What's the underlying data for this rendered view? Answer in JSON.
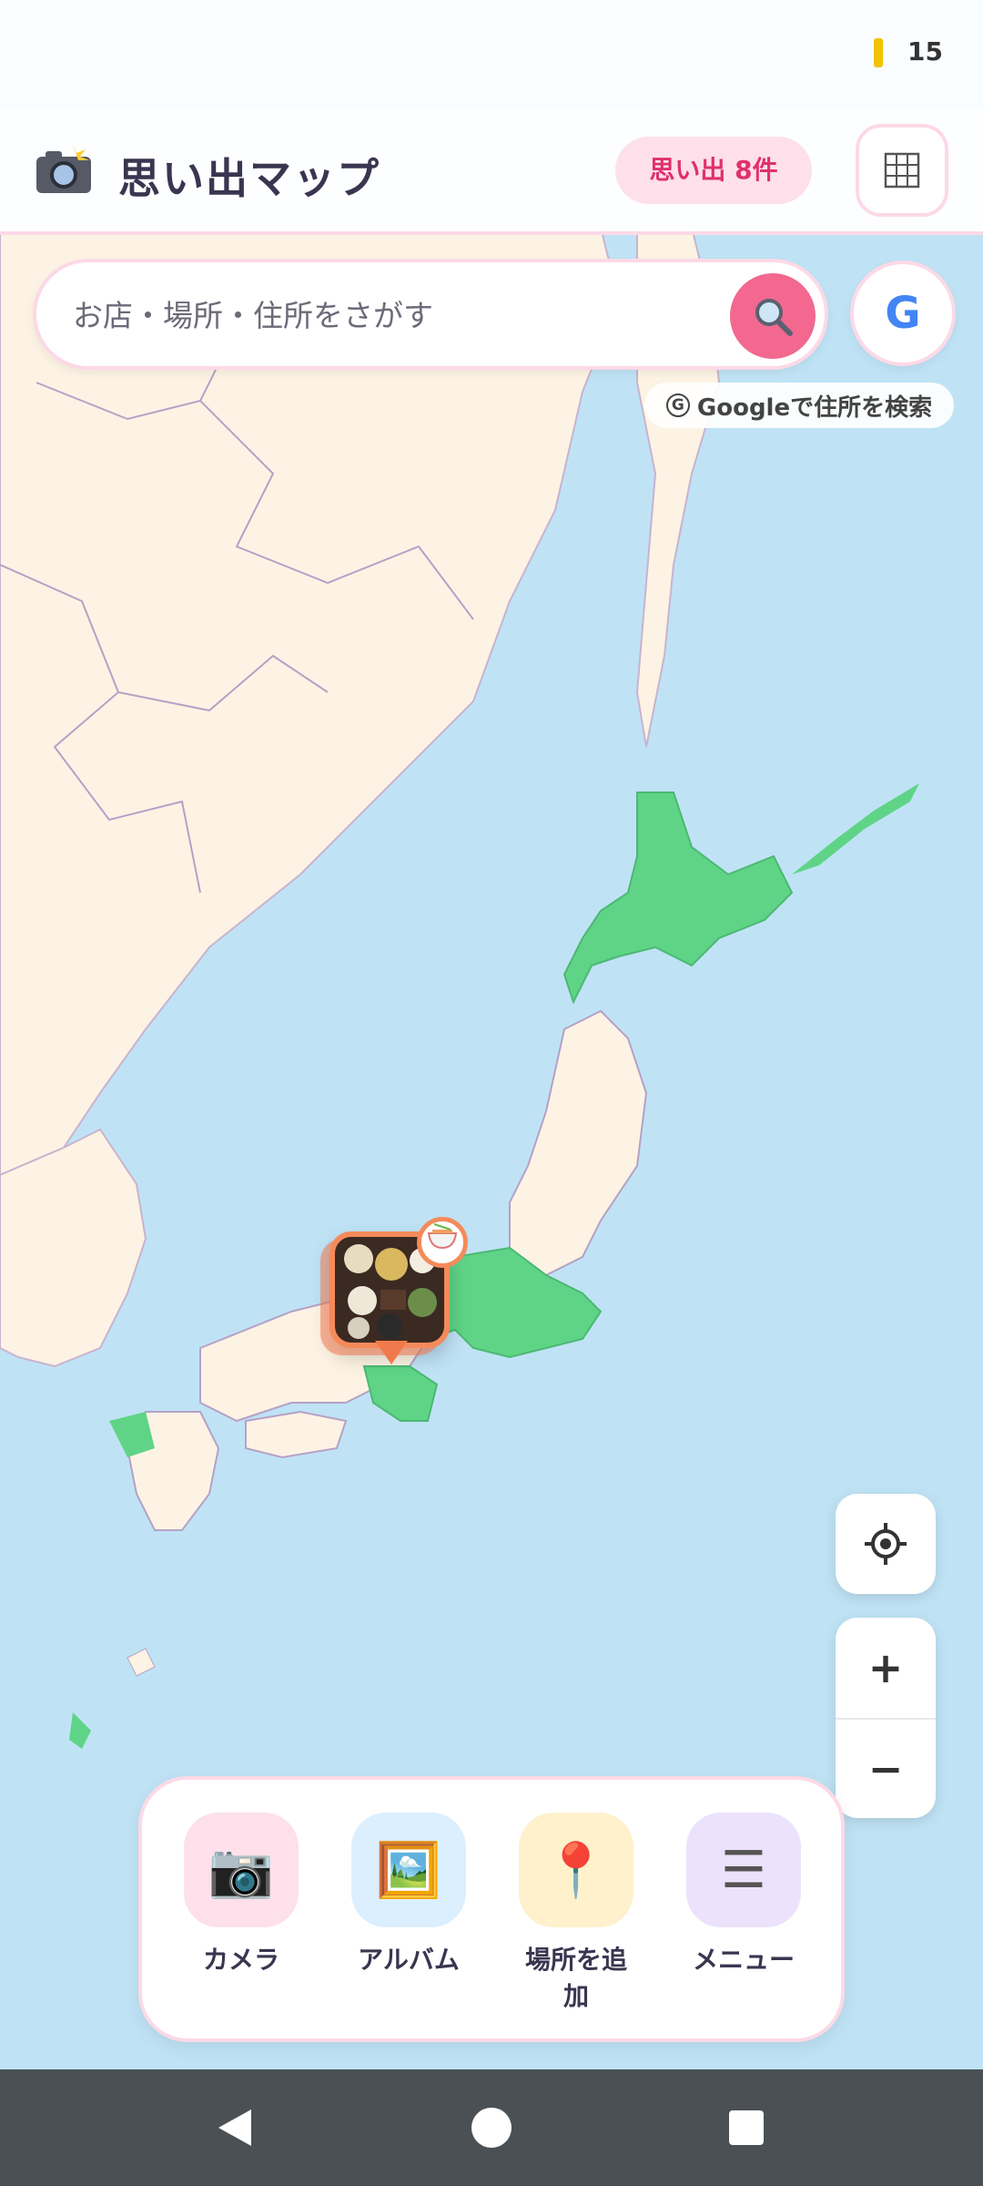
{
  "status_bar": {
    "battery_level": "15",
    "battery_color": "#f2c300"
  },
  "header": {
    "app_icon": "camera-flash-icon",
    "title": "思い出マップ",
    "memory_count_badge": "思い出 8件",
    "grid_button_icon": "grid-icon"
  },
  "search": {
    "placeholder": "お店・場所・住所をさがす",
    "value": "",
    "search_button_icon": "magnifier-icon",
    "google_button_label": "G",
    "google_hint_icon": "G",
    "google_hint": "Googleで住所を検索"
  },
  "map": {
    "memory_pin": {
      "photo": "japanese-set-meal-photo",
      "category_icon": "ramen-bowl-icon"
    },
    "visited_region_color": "#5fd487",
    "land_color": "#fdf3e4",
    "sea_color": "#bfe3f5"
  },
  "controls": {
    "locate_icon": "crosshair-locate-icon",
    "zoom_in_label": "+",
    "zoom_out_label": "−"
  },
  "actions": [
    {
      "label": "カメラ",
      "icon": "camera-icon",
      "bg": "#fde0ea",
      "glyph": "📷"
    },
    {
      "label": "アルバム",
      "icon": "framed-picture-icon",
      "bg": "#dcefff",
      "glyph": "🖼️"
    },
    {
      "label": "場所を追加",
      "icon": "map-pin-icon",
      "bg": "#fff1cc",
      "glyph": "📍"
    },
    {
      "label": "メニュー",
      "icon": "hamburger-menu-icon",
      "bg": "#ece2fb",
      "glyph": "☰"
    }
  ],
  "nav": {
    "back": "back-icon",
    "home": "home-icon",
    "recents": "recents-icon"
  }
}
